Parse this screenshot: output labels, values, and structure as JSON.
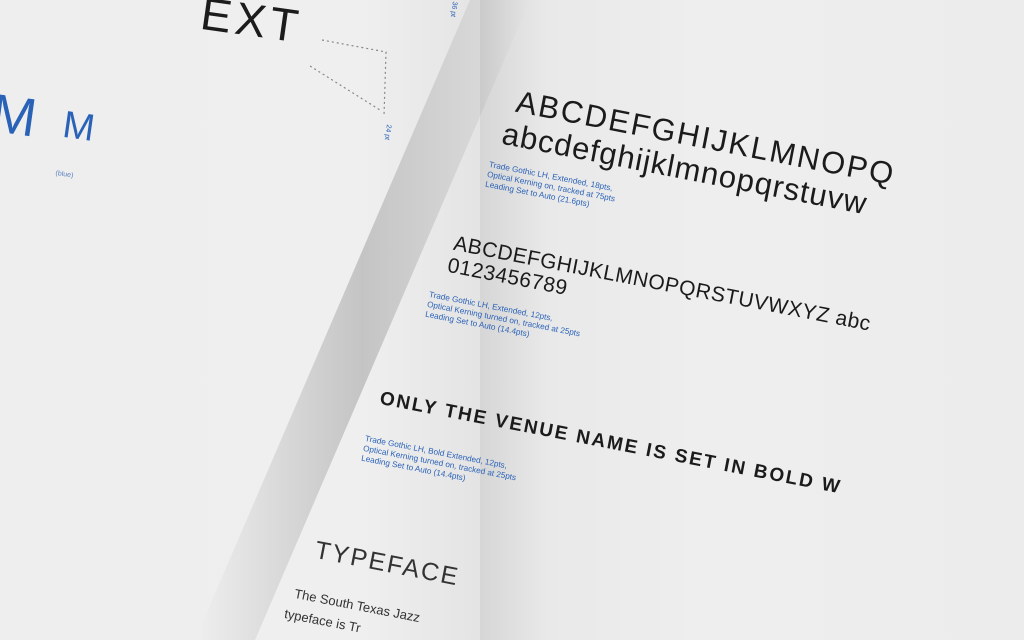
{
  "left_page": {
    "heading_fragment": "EXT",
    "big_m": "M",
    "small_m": "M",
    "tiny_label": "(blue)",
    "dim_top": "36 pt",
    "dim_right": "24 pt"
  },
  "specimens": [
    {
      "line1": "ABCDEFGHIJKLMNOPQ",
      "line2": "abcdefghijklmnopqrstuvw",
      "caption": [
        "Trade Gothic LH, Extended, 18pts,",
        "Optical Kerning on, tracked at 75pts",
        "Leading Set to Auto (21.6pts)"
      ]
    },
    {
      "line1": "ABCDEFGHIJKLMNOPQRSTUVWXYZ abc",
      "line2": "0123456789",
      "caption": [
        "Trade Gothic LH, Extended, 12pts,",
        "Optical Kerning turned on, tracked at 25pts",
        "Leading Set to Auto (14.4pts)"
      ]
    },
    {
      "line1": "ONLY THE VENUE NAME IS SET IN BOLD W",
      "caption": [
        "Trade Gothic LH, Bold Extended, 12pts,",
        "Optical Kerning turned on, tracked at 25pts",
        "Leading Set to Auto (14.4pts)"
      ]
    }
  ],
  "typeface_section": {
    "heading": "TYPEFACE",
    "body_line1": "The South Texas Jazz",
    "body_line2": "typeface is Tr"
  }
}
